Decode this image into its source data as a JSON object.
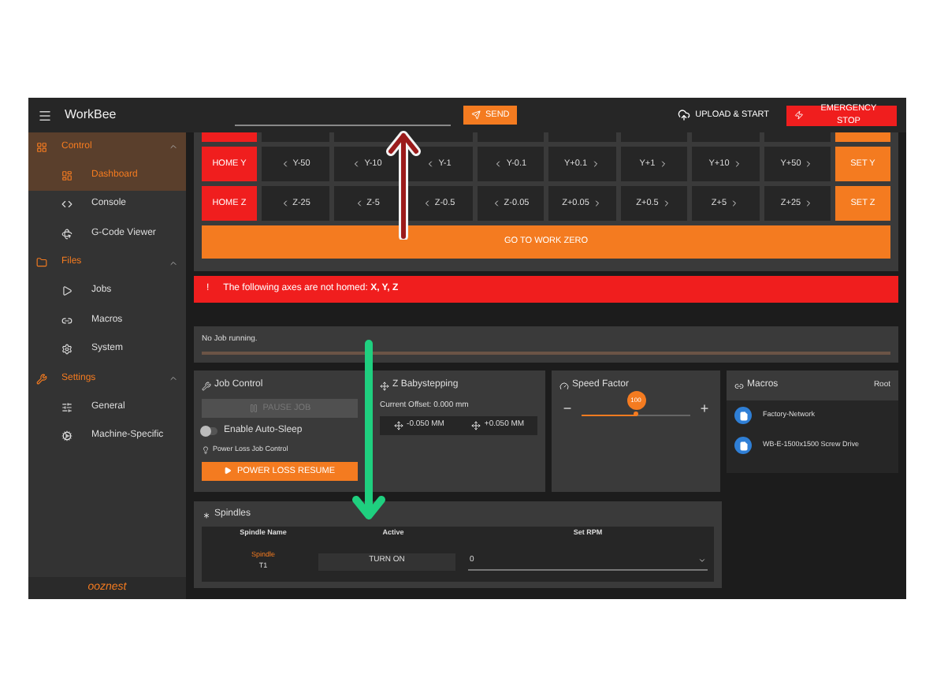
{
  "app_bar": {
    "title": "WorkBee",
    "send_button": "SEND",
    "upload_button": "UPLOAD & START",
    "emergency_button": "EMERGENCY STOP"
  },
  "sidebar": {
    "groups": [
      {
        "label": "Control",
        "expanded": true,
        "items": [
          {
            "label": "Dashboard",
            "selected": true
          },
          {
            "label": "Console",
            "selected": false
          },
          {
            "label": "G-Code Viewer",
            "selected": false
          }
        ]
      },
      {
        "label": "Files",
        "expanded": true,
        "items": [
          {
            "label": "Jobs",
            "selected": false
          },
          {
            "label": "Macros",
            "selected": false
          },
          {
            "label": "System",
            "selected": false
          }
        ]
      },
      {
        "label": "Settings",
        "expanded": true,
        "items": [
          {
            "label": "General",
            "selected": false
          },
          {
            "label": "Machine-Specific",
            "selected": false
          }
        ]
      }
    ],
    "footer_logo": "ooznest"
  },
  "jog": {
    "rows": [
      {
        "home": "HOME Y",
        "set": "SET Y",
        "buttons": [
          {
            "label": "Y-50",
            "kind": "decrease"
          },
          {
            "label": "Y-10",
            "kind": "decrease"
          },
          {
            "label": "Y-1",
            "kind": "decrease"
          },
          {
            "label": "Y-0.1",
            "kind": "decrease"
          },
          {
            "label": "Y+0.1",
            "kind": "increase"
          },
          {
            "label": "Y+1",
            "kind": "increase"
          },
          {
            "label": "Y+10",
            "kind": "increase"
          },
          {
            "label": "Y+50",
            "kind": "increase"
          }
        ]
      },
      {
        "home": "HOME Z",
        "set": "SET Z",
        "buttons": [
          {
            "label": "Z-25",
            "kind": "decrease"
          },
          {
            "label": "Z-5",
            "kind": "decrease"
          },
          {
            "label": "Z-0.5",
            "kind": "decrease"
          },
          {
            "label": "Z-0.05",
            "kind": "decrease"
          },
          {
            "label": "Z+0.05",
            "kind": "increase"
          },
          {
            "label": "Z+0.5",
            "kind": "increase"
          },
          {
            "label": "Z+5",
            "kind": "increase"
          },
          {
            "label": "Z+25",
            "kind": "increase"
          }
        ]
      }
    ],
    "go_to_zero": "GO TO WORK ZERO"
  },
  "alert": {
    "icon": "!",
    "text": "The following axes are not homed: **X, Y, Z**"
  },
  "job_status": {
    "text": "No Job running.",
    "level": 0
  },
  "job_control": {
    "title": "Job Control",
    "pause_button": {
      "label": "PAUSE JOB",
      "disabled": true
    },
    "auto_sleep": {
      "label": "Enable Auto-Sleep",
      "on": false
    },
    "power_loss_label": "Power Loss Job Control",
    "resume_button": "POWER LOSS RESUME"
  },
  "z_babystepping": {
    "title": "Z Babystepping",
    "offset": "Current Offset: 0.000 mm",
    "buttons": [
      "-0.050 MM",
      "+0.050 MM"
    ]
  },
  "speed_factor": {
    "title": "Speed Factor",
    "minus": "−",
    "plus": "+",
    "value": "100",
    "level": 0.5
  },
  "macros": {
    "title": "Macros",
    "root": "Root",
    "items": [
      "Factory-Network",
      "WB-E-1500x1500 Screw Drive"
    ]
  },
  "spindles": {
    "title": "Spindles",
    "columns": [
      "Spindle Name",
      "Active",
      "Set RPM"
    ],
    "rows": [
      {
        "name": "Spindle",
        "tool": "T1",
        "button": "TURN ON",
        "rpm": "0"
      }
    ]
  }
}
